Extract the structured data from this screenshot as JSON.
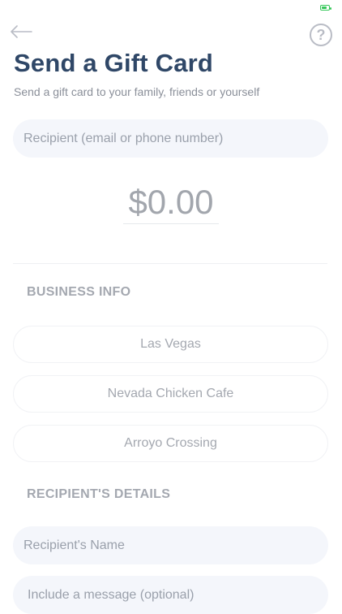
{
  "header": {
    "title": "Send a Gift Card",
    "subtitle": "Send a gift card to your family, friends or yourself",
    "back_icon": "arrow-left-icon",
    "help_icon": "question-circle-icon",
    "help_glyph": "?"
  },
  "form": {
    "recipient_placeholder": "Recipient (email or phone number)",
    "amount": "$0.00"
  },
  "business_info": {
    "heading": "BUSINESS INFO",
    "options": [
      "Las Vegas",
      "Nevada Chicken Cafe",
      "Arroyo Crossing"
    ]
  },
  "recipient_details": {
    "heading": "RECIPIENT'S DETAILS",
    "name_placeholder": "Recipient's Name",
    "message_placeholder": "Include a message (optional)"
  },
  "colors": {
    "title": "#2f4767",
    "muted_text": "#a4a8b0",
    "input_bg": "#f4f6fb",
    "battery": "#35c759"
  }
}
